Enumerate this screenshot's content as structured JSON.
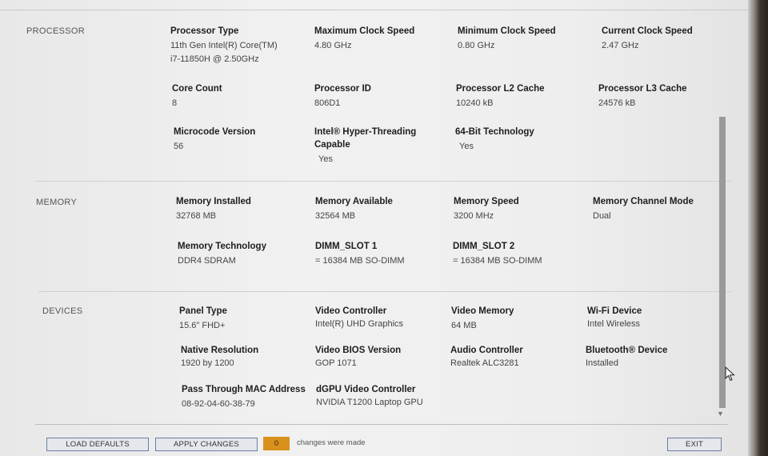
{
  "processor": {
    "title": "PROCESSOR",
    "fields": [
      {
        "label": "Processor Type",
        "value": "11th Gen Intel(R) Core(TM)",
        "value2": "i7-11850H @ 2.50GHz"
      },
      {
        "label": "Maximum Clock Speed",
        "value": "4.80 GHz"
      },
      {
        "label": "Minimum Clock Speed",
        "value": "0.80 GHz"
      },
      {
        "label": "Current Clock Speed",
        "value": "2.47 GHz"
      },
      {
        "label": "Core Count",
        "value": "8"
      },
      {
        "label": "Processor ID",
        "value": "806D1"
      },
      {
        "label": "Processor L2 Cache",
        "value": "10240 kB"
      },
      {
        "label": "Processor L3 Cache",
        "value": "24576 kB"
      },
      {
        "label": "Microcode Version",
        "value": "56"
      },
      {
        "label": "Intel® Hyper-Threading Capable",
        "value": "Yes"
      },
      {
        "label": "64-Bit Technology",
        "value": "Yes"
      }
    ]
  },
  "memory": {
    "title": "MEMORY",
    "fields": [
      {
        "label": "Memory Installed",
        "value": "32768 MB"
      },
      {
        "label": "Memory Available",
        "value": "32564 MB"
      },
      {
        "label": "Memory Speed",
        "value": "3200 MHz"
      },
      {
        "label": "Memory Channel Mode",
        "value": "Dual"
      },
      {
        "label": "Memory Technology",
        "value": "DDR4 SDRAM"
      },
      {
        "label": "DIMM_SLOT 1",
        "value": "= 16384 MB SO-DIMM"
      },
      {
        "label": "DIMM_SLOT 2",
        "value": "= 16384 MB SO-DIMM"
      }
    ]
  },
  "devices": {
    "title": "DEVICES",
    "fields": [
      {
        "label": "Panel Type",
        "value": "15.6\" FHD+"
      },
      {
        "label": "Video Controller",
        "value": "Intel(R) UHD Graphics"
      },
      {
        "label": "Video Memory",
        "value": "64 MB"
      },
      {
        "label": "Wi-Fi Device",
        "value": "Intel Wireless"
      },
      {
        "label": "Native Resolution",
        "value": "1920 by 1200"
      },
      {
        "label": "Video BIOS Version",
        "value": "GOP 1071"
      },
      {
        "label": "Audio Controller",
        "value": "Realtek ALC3281"
      },
      {
        "label": "Bluetooth® Device",
        "value": "Installed"
      },
      {
        "label": "Pass Through MAC Address",
        "value": "08-92-04-60-38-79"
      },
      {
        "label": "dGPU Video Controller",
        "value": "NVIDIA T1200 Laptop GPU"
      }
    ]
  },
  "footer": {
    "load_defaults": "LOAD DEFAULTS",
    "apply_changes": "APPLY CHANGES",
    "changes_count": "0",
    "changes_text": "changes were made",
    "exit": "EXIT"
  },
  "icons": {
    "scroll_down": "triangle-down",
    "cursor": "mouse-pointer"
  }
}
